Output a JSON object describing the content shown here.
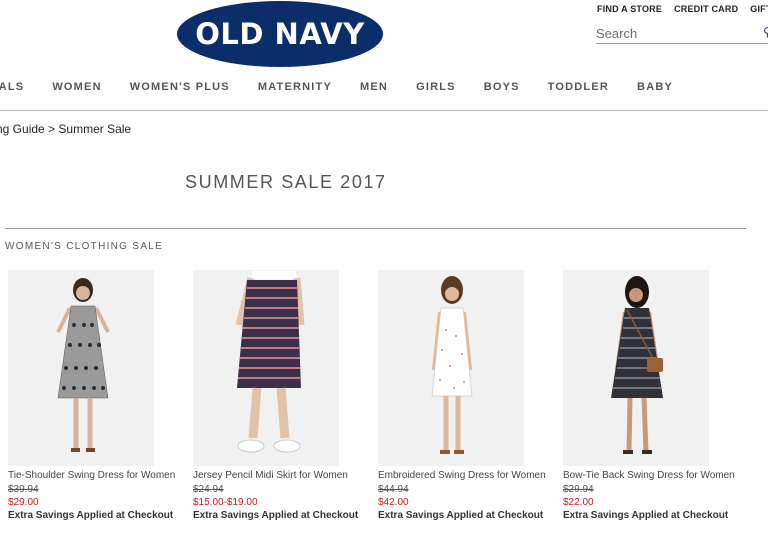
{
  "brand": {
    "logo_text": "OLD NAVY"
  },
  "utility_links": [
    "FIND A STORE",
    "CREDIT CARD",
    "GIFT CA"
  ],
  "search": {
    "placeholder": "Search"
  },
  "nav": [
    "VALS",
    "WOMEN",
    "WOMEN'S PLUS",
    "MATERNITY",
    "MEN",
    "GIRLS",
    "BOYS",
    "TODDLER",
    "BABY"
  ],
  "breadcrumb": {
    "parent": "ng Guide",
    "separator": ">",
    "current": "Summer Sale"
  },
  "page_title": "SUMMER SALE 2017",
  "section_title": "WOMEN'S CLOTHING SALE",
  "products": [
    {
      "name": "Tie-Shoulder Swing Dress for Women",
      "was": "$39.94",
      "now": "$29.00",
      "note": "Extra Savings Applied at Checkout"
    },
    {
      "name": "Jersey Pencil Midi Skirt for Women",
      "was": "$24.94",
      "now": "$15.00-$19.00",
      "note": "Extra Savings Applied at Checkout"
    },
    {
      "name": "Embroidered Swing Dress for Women",
      "was": "$44.94",
      "now": "$42.00",
      "note": "Extra Savings Applied at Checkout"
    },
    {
      "name": "Bow-Tie Back Swing Dress for Women",
      "was": "$29.94",
      "now": "$22.00",
      "note": "Extra Savings Applied at Checkout"
    }
  ],
  "colors": {
    "brand_navy": "#0b2e6a",
    "sale_red": "#cc1a1a"
  }
}
